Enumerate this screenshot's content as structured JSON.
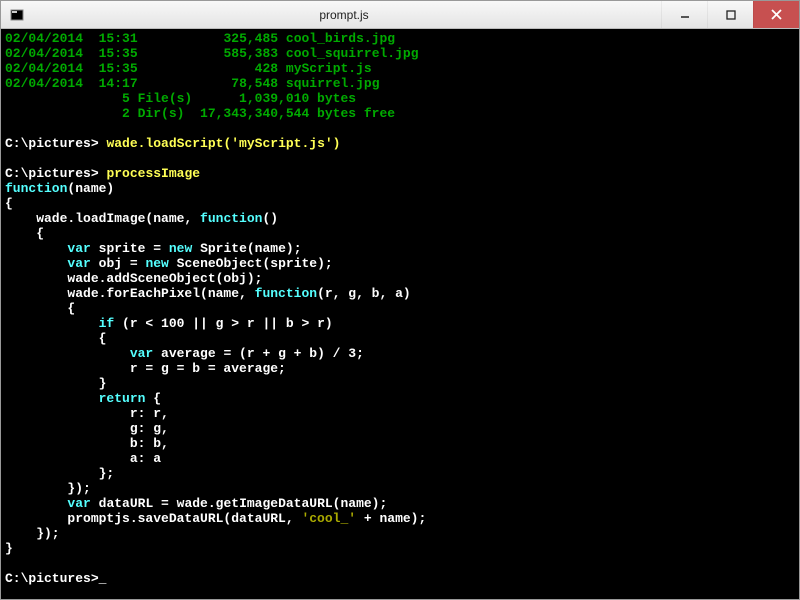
{
  "window": {
    "title": "prompt.js"
  },
  "dir_listing": [
    {
      "date": "02/04/2014",
      "time": "15:31",
      "size": "325,485",
      "name": "cool_birds.jpg"
    },
    {
      "date": "02/04/2014",
      "time": "15:35",
      "size": "585,383",
      "name": "cool_squirrel.jpg"
    },
    {
      "date": "02/04/2014",
      "time": "15:35",
      "size": "428",
      "name": "myScript.js"
    },
    {
      "date": "02/04/2014",
      "time": "14:17",
      "size": "78,548",
      "name": "squirrel.jpg"
    }
  ],
  "dir_summary": {
    "files": "               5 File(s)      1,039,010 bytes",
    "dirs": "               2 Dir(s)  17,343,340,544 bytes free"
  },
  "prompt": "C:\\pictures>",
  "cmd1": "wade.loadScript('myScript.js')",
  "cmd2": "processImage",
  "code": {
    "l1a": "function",
    "l1b": "(name)",
    "l2": "{",
    "l3a": "    wade.loadImage(name, ",
    "l3b": "function",
    "l3c": "()",
    "l4": "    {",
    "l5a": "        ",
    "l5b": "var ",
    "l5c": "sprite = ",
    "l5d": "new ",
    "l5e": "Sprite(name);",
    "l6a": "        ",
    "l6b": "var ",
    "l6c": "obj = ",
    "l6d": "new ",
    "l6e": "SceneObject(sprite);",
    "l7": "        wade.addSceneObject(obj);",
    "l8a": "        wade.forEachPixel(name, ",
    "l8b": "function",
    "l8c": "(r, g, b, a)",
    "l9": "        {",
    "l10a": "            ",
    "l10b": "if ",
    "l10c": "(r < 100 || g > r || b > r)",
    "l11": "            {",
    "l12a": "                ",
    "l12b": "var ",
    "l12c": "average = (r + g + b) / 3;",
    "l13": "                r = g = b = average;",
    "l14": "            }",
    "l15a": "            ",
    "l15b": "return ",
    "l15c": "{",
    "l16": "                r: r,",
    "l17": "                g: g,",
    "l18": "                b: b,",
    "l19": "                a: a",
    "l20": "            };",
    "l21": "        });",
    "l22a": "        ",
    "l22b": "var ",
    "l22c": "dataURL = wade.getImageDataURL(name);",
    "l23a": "        promptjs.saveDataURL(dataURL, ",
    "l23b": "'cool_'",
    "l23c": " + name);",
    "l24": "    });",
    "l25": "}"
  },
  "cursor": "_"
}
